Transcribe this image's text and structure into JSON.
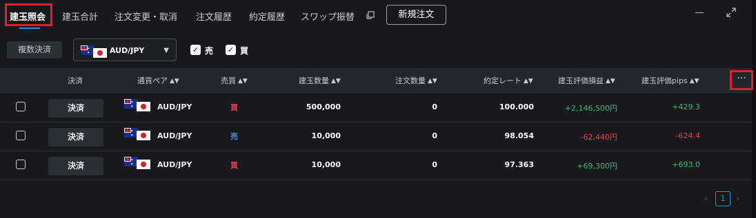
{
  "tabs": [
    {
      "label": "建玉照会",
      "active": true
    },
    {
      "label": "建玉合計"
    },
    {
      "label": "注文変更・取消"
    },
    {
      "label": "注文履歴"
    },
    {
      "label": "約定履歴"
    },
    {
      "label": "スワップ振替"
    }
  ],
  "new_order_label": "新規注文",
  "toolbar": {
    "bulk_settle_label": "複数決済",
    "pair_select_value": "AUD/JPY",
    "checkbox_sell_label": "売",
    "checkbox_buy_label": "買",
    "sell_checked": true,
    "buy_checked": true
  },
  "table": {
    "columns": {
      "settle": "決済",
      "pair": "通貨ペア",
      "side": "売買",
      "quantity": "建玉数量",
      "order_qty": "注文数量",
      "rate": "約定レート",
      "pl": "建玉評価損益",
      "pips": "建玉評価pips"
    },
    "more_label": "···",
    "settle_button_label": "決済",
    "rows": [
      {
        "pair": "AUD/JPY",
        "side": "買",
        "quantity": "500,000",
        "order_qty": "0",
        "rate": "100.000",
        "pl": "+2,146,500円",
        "pips": "+429.3"
      },
      {
        "pair": "AUD/JPY",
        "side": "売",
        "quantity": "10,000",
        "order_qty": "0",
        "rate": "98.054",
        "pl": "-62,440円",
        "pips": "-624.4"
      },
      {
        "pair": "AUD/JPY",
        "side": "買",
        "quantity": "10,000",
        "order_qty": "0",
        "rate": "97.363",
        "pl": "+69,300円",
        "pips": "+693.0"
      }
    ]
  },
  "pagination": {
    "current_page": "1",
    "prev": "‹",
    "next": "›"
  },
  "colors": {
    "accent": "#2f8fd6",
    "buy": "#e2444c",
    "sell": "#4d8fd8",
    "positive": "#3fb96b",
    "highlight": "#e0202a"
  }
}
